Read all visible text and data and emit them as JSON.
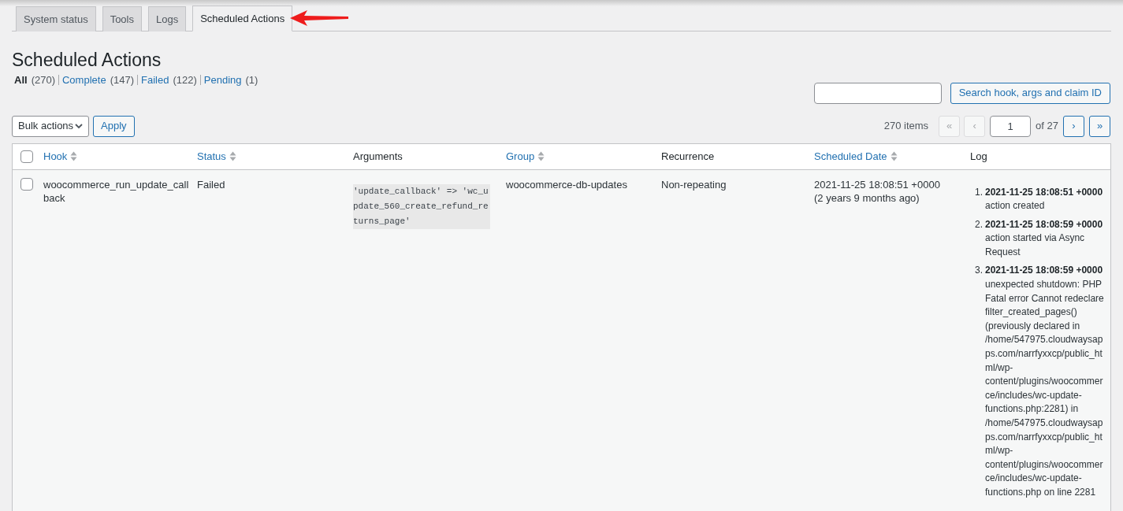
{
  "tabs": [
    {
      "label": "System status",
      "selected": false
    },
    {
      "label": "Tools",
      "selected": false
    },
    {
      "label": "Logs",
      "selected": false
    },
    {
      "label": "Scheduled Actions",
      "selected": true
    }
  ],
  "title": "Scheduled Actions",
  "filters": [
    {
      "label": "All",
      "count": "(270)",
      "selected": true
    },
    {
      "label": "Complete",
      "count": "(147)",
      "selected": false
    },
    {
      "label": "Failed",
      "count": "(122)",
      "selected": false
    },
    {
      "label": "Pending",
      "count": "(1)",
      "selected": false
    }
  ],
  "search": {
    "button": "Search hook, args and claim ID"
  },
  "bulk_actions": {
    "value": "Bulk actions",
    "apply": "Apply"
  },
  "pagination": {
    "items": "270 items",
    "first": "«",
    "prev": "‹",
    "page": "1",
    "of": "of 27",
    "next": "›",
    "last": "»"
  },
  "table": {
    "select_all_checked": false,
    "columns": [
      {
        "label": "Hook",
        "sortable": true
      },
      {
        "label": "Status",
        "sortable": true
      },
      {
        "label": "Arguments",
        "sortable": false
      },
      {
        "label": "Group",
        "sortable": true
      },
      {
        "label": "Recurrence",
        "sortable": false
      },
      {
        "label": "Scheduled Date",
        "sortable": true
      },
      {
        "label": "Log",
        "sortable": false
      }
    ],
    "rows": [
      {
        "checked": false,
        "hook": "woocommerce_run_update_callback",
        "status": "Failed",
        "arguments": "'update_callback' => 'wc_update_560_create_refund_returns_page'",
        "group": "woocommerce-db-updates",
        "recurrence": "Non-repeating",
        "scheduled_date": "2021-11-25 18:08:51 +0000",
        "scheduled_ago": "(2 years 9 months ago)",
        "log": [
          {
            "number": "1.",
            "time": "2021-11-25 18:08:51 +0000",
            "message": "action created"
          },
          {
            "number": "2.",
            "time": "2021-11-25 18:08:59 +0000",
            "message": "action started via Async Request"
          },
          {
            "number": "3.",
            "time": "2021-11-25 18:08:59 +0000",
            "message": "unexpected shutdown: PHP Fatal error Cannot redeclare filter_created_pages() (previously declared in /home/547975.cloudwaysapps.com/narrfyxxcp/public_html/wp-content/plugins/woocommerce/includes/wc-update-functions.php:2281) in /home/547975.cloudwaysapps.com/narrfyxxcp/public_html/wp-content/plugins/woocommerce/includes/wc-update-functions.php on line 2281"
          }
        ]
      }
    ]
  }
}
